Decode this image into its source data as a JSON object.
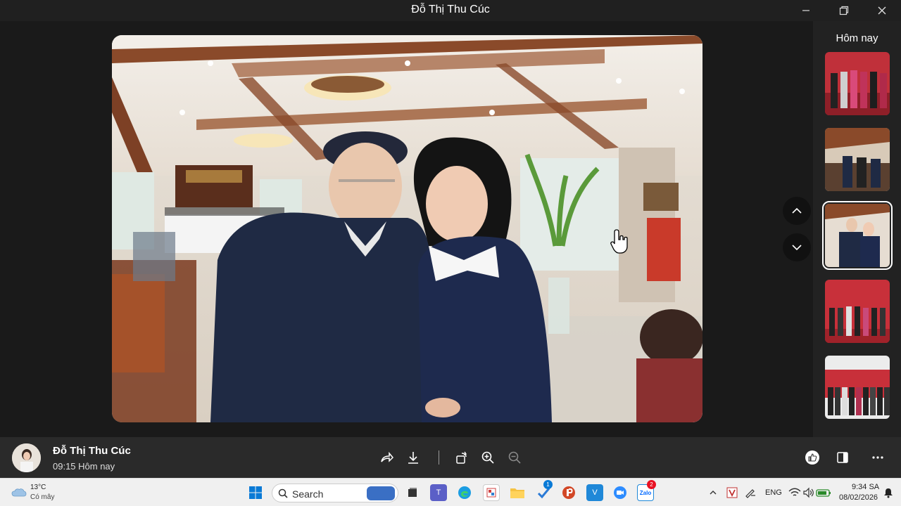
{
  "window": {
    "title": "Đỗ Thị Thu Cúc"
  },
  "sidebar": {
    "header": "Hôm nay"
  },
  "photo_info": {
    "author": "Đỗ Thị Thu Cúc",
    "time": "09:15 Hôm nay"
  },
  "taskbar": {
    "weather_temp": "13°C",
    "weather_condition": "Có mây",
    "search_label": "Search",
    "language": "ENG",
    "clock_time": "9:34 SA",
    "clock_date": "08/02/2026",
    "teams_badge": "1",
    "zalo_badge": "2"
  },
  "icons": {
    "minimize": "minimize-icon",
    "maximize": "restore-icon",
    "close": "close-icon",
    "up": "chevron-up-icon",
    "down": "chevron-down-icon",
    "share": "share-icon",
    "download": "download-icon",
    "rotate": "rotate-icon",
    "zoom_in": "zoom-in-icon",
    "zoom_out": "zoom-out-icon",
    "like": "like-icon",
    "panel": "panel-icon",
    "more": "more-icon"
  },
  "colors": {
    "accent": "#0078d4",
    "badge_red": "#e81123"
  }
}
